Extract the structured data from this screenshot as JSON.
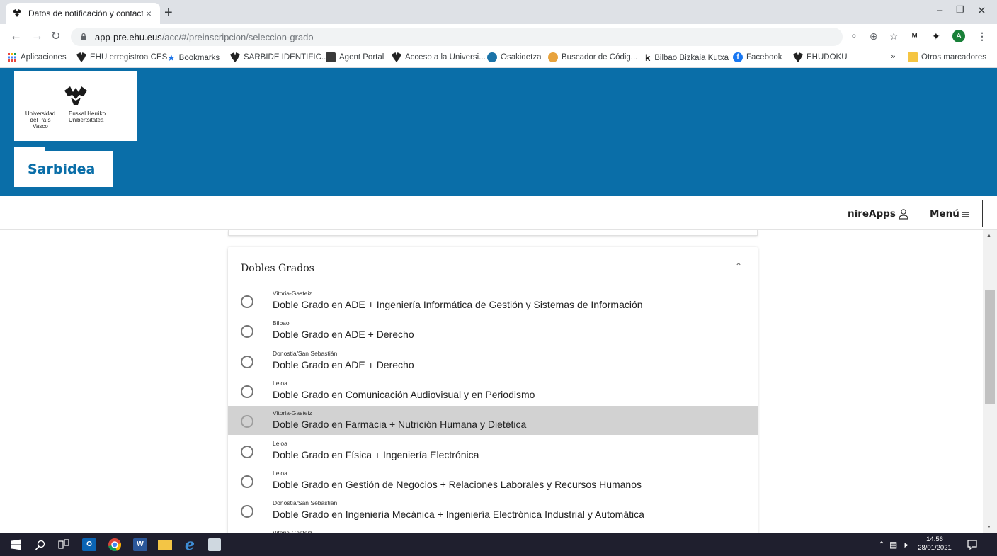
{
  "browser": {
    "tab_title": "Datos de notificación y contacto",
    "tab_close": "×",
    "new_tab": "+",
    "url_host": "app-pre.ehu.eus",
    "url_path": "/acc/#/preinscripcion/seleccion-grado",
    "profile_initial": "A"
  },
  "bookmarks": {
    "items": [
      {
        "label": "Aplicaciones",
        "icon": "apps-grid-icon"
      },
      {
        "label": "EHU erregistroa CES",
        "icon": "ehu-icon"
      },
      {
        "label": "Bookmarks",
        "icon": "star-icon"
      },
      {
        "label": "SARBIDE IDENTIFIC...",
        "icon": "ehu-icon"
      },
      {
        "label": "Agent Portal",
        "icon": "portal-icon"
      },
      {
        "label": "Acceso a la Universi...",
        "icon": "ehu-icon"
      },
      {
        "label": "Osakidetza",
        "icon": "osakidetza-icon"
      },
      {
        "label": "Buscador de Códig...",
        "icon": "search-globe-icon"
      },
      {
        "label": "Bilbao Bizkaia Kutxa",
        "icon": "kutxa-icon"
      },
      {
        "label": "Facebook",
        "icon": "facebook-icon"
      },
      {
        "label": "EHUDOKU",
        "icon": "ehu-icon"
      }
    ],
    "overflow": "»",
    "other_folder": "Otros marcadores"
  },
  "site": {
    "logo_left_line1": "Universidad",
    "logo_left_line2": "del País Vasco",
    "logo_right_line1": "Euskal Herriko",
    "logo_right_line2": "Unibertsitatea",
    "app_name": "Sarbidea",
    "nireapps_label": "nireApps",
    "menu_label": "Menú"
  },
  "card": {
    "title": "Dobles Grados",
    "options": [
      {
        "campus": "Vitoria-Gasteiz",
        "degree": "Doble Grado en ADE + Ingeniería Informática de Gestión y Sistemas de Información",
        "selected": false
      },
      {
        "campus": "Bilbao",
        "degree": "Doble Grado en ADE + Derecho",
        "selected": false
      },
      {
        "campus": "Donostia/San Sebastián",
        "degree": "Doble Grado en ADE + Derecho",
        "selected": false
      },
      {
        "campus": "Leioa",
        "degree": "Doble Grado en Comunicación Audiovisual y en Periodismo",
        "selected": false
      },
      {
        "campus": "Vitoria-Gasteiz",
        "degree": "Doble Grado en Farmacia + Nutrición Humana y Dietética",
        "selected": false,
        "highlighted": true
      },
      {
        "campus": "Leioa",
        "degree": "Doble Grado en Física + Ingeniería Electrónica",
        "selected": false
      },
      {
        "campus": "Leioa",
        "degree": "Doble Grado en Gestión de Negocios + Relaciones Laborales y Recursos Humanos",
        "selected": false
      },
      {
        "campus": "Donostia/San Sebastián",
        "degree": "Doble Grado en Ingeniería Mecánica + Ingeniería Electrónica Industrial y Automática",
        "selected": false
      },
      {
        "campus": "Vitoria-Gasteiz",
        "degree": "",
        "selected": false
      }
    ]
  },
  "taskbar": {
    "time": "14:56",
    "date": "28/01/2021"
  },
  "colors": {
    "header_blue": "#0a6ea8",
    "highlight_gray": "#d2d2d2",
    "taskbar": "#1f1f2e"
  }
}
